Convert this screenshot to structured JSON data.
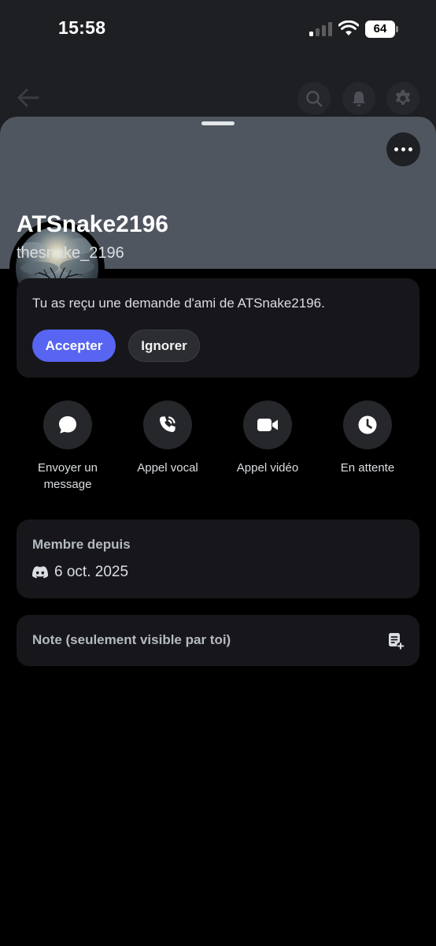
{
  "status_bar": {
    "time": "15:58",
    "battery_level": "64",
    "signal_bars_active": 1,
    "icons": [
      "signal-icon",
      "wifi-icon",
      "battery-icon"
    ]
  },
  "nav": {
    "icons": [
      "back-arrow-icon",
      "search-icon",
      "bell-icon",
      "gear-icon"
    ]
  },
  "sheet": {
    "banner_color": "#4f5660",
    "more_icon": "more-horizontal-icon"
  },
  "profile": {
    "display_name": "ATSnake2196",
    "username": "thesnake_2196",
    "status_icon": "offline-status-icon"
  },
  "friend_request": {
    "message": "Tu as reçu une demande d'ami de ATSnake2196.",
    "accept_label": "Accepter",
    "ignore_label": "Ignorer"
  },
  "actions": [
    {
      "label": "Envoyer un message",
      "icon": "message-icon"
    },
    {
      "label": "Appel vocal",
      "icon": "phone-call-icon"
    },
    {
      "label": "Appel vidéo",
      "icon": "video-camera-icon"
    },
    {
      "label": "En attente",
      "icon": "clock-icon"
    }
  ],
  "member_since": {
    "title": "Membre depuis",
    "date": "6 oct. 2025",
    "icon": "discord-logo-icon"
  },
  "note": {
    "placeholder": "Note (seulement visible par toi)",
    "icon": "note-add-icon"
  },
  "colors": {
    "accent": "#5865f2",
    "card_bg": "#17171b",
    "button_circle_bg": "#26272b",
    "offline_status": "#80848e"
  }
}
